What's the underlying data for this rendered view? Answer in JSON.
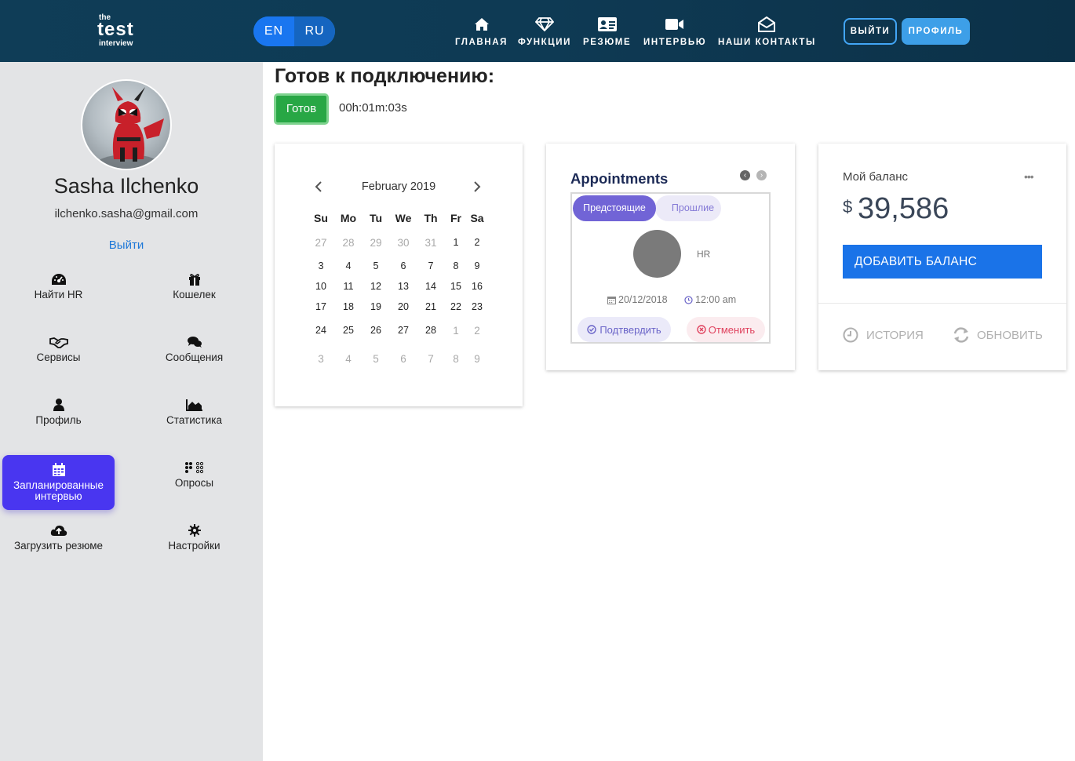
{
  "brand": {
    "line1": "the",
    "line2": "test",
    "line3": "interview"
  },
  "languages": [
    "EN",
    "RU"
  ],
  "nav": [
    {
      "label": "ГЛАВНАЯ",
      "icon": "home-icon"
    },
    {
      "label": "ФУНКЦИИ",
      "icon": "diamond-icon"
    },
    {
      "label": "РЕЗЮМЕ",
      "icon": "id-card-icon"
    },
    {
      "label": "ИНТЕРВЬЮ",
      "icon": "video-camera-icon"
    },
    {
      "label": "НАШИ КОНТАКТЫ",
      "icon": "envelope-open-icon"
    }
  ],
  "header_buttons": {
    "logout": "ВЫЙТИ",
    "profile": "ПРОФИЛЬ"
  },
  "user": {
    "name": "Sasha Ilchenko",
    "email": "ilchenko.sasha@gmail.com",
    "logout": "Выйти"
  },
  "sidebar": [
    {
      "label": "Найти HR",
      "icon": "dashboard-icon"
    },
    {
      "label": "Кошелек",
      "icon": "gift-icon"
    },
    {
      "label": "Сервисы",
      "icon": "handshake-icon"
    },
    {
      "label": "Сообщения",
      "icon": "comments-icon"
    },
    {
      "label": "Профиль",
      "icon": "user-icon"
    },
    {
      "label": "Статистика",
      "icon": "area-chart-icon"
    },
    {
      "label": "Запланированные интервью",
      "icon": "calendar-icon",
      "active": true
    },
    {
      "label": "Опросы",
      "icon": "braille-icon"
    },
    {
      "label": "Загрузить резюме",
      "icon": "cloud-upload-icon"
    },
    {
      "label": "Настройки",
      "icon": "gear-icon"
    }
  ],
  "main": {
    "title": "Готов к подключению:",
    "ready_button": "Готов",
    "timer": "00h:01m:03s"
  },
  "calendar": {
    "month": "February 2019",
    "weekdays": [
      "Su",
      "Mo",
      "Tu",
      "We",
      "Th",
      "Fr",
      "Sa"
    ],
    "weeks": [
      [
        {
          "d": "27",
          "m": true
        },
        {
          "d": "28",
          "m": true
        },
        {
          "d": "29",
          "m": true
        },
        {
          "d": "30",
          "m": true
        },
        {
          "d": "31",
          "m": true
        },
        {
          "d": "1"
        },
        {
          "d": "2"
        }
      ],
      [
        {
          "d": "3"
        },
        {
          "d": "4"
        },
        {
          "d": "5"
        },
        {
          "d": "6"
        },
        {
          "d": "7"
        },
        {
          "d": "8"
        },
        {
          "d": "9"
        }
      ],
      [
        {
          "d": "10"
        },
        {
          "d": "11"
        },
        {
          "d": "12"
        },
        {
          "d": "13"
        },
        {
          "d": "14"
        },
        {
          "d": "15"
        },
        {
          "d": "16"
        }
      ],
      [
        {
          "d": "17"
        },
        {
          "d": "18"
        },
        {
          "d": "19"
        },
        {
          "d": "20"
        },
        {
          "d": "21"
        },
        {
          "d": "22"
        },
        {
          "d": "23"
        }
      ],
      [
        {
          "d": "24"
        },
        {
          "d": "25"
        },
        {
          "d": "26"
        },
        {
          "d": "27"
        },
        {
          "d": "28"
        },
        {
          "d": "1",
          "m": true
        },
        {
          "d": "2",
          "m": true
        }
      ],
      [
        {
          "d": "3",
          "m": true
        },
        {
          "d": "4",
          "m": true
        },
        {
          "d": "5",
          "m": true
        },
        {
          "d": "6",
          "m": true
        },
        {
          "d": "7",
          "m": true
        },
        {
          "d": "8",
          "m": true
        },
        {
          "d": "9",
          "m": true
        }
      ]
    ]
  },
  "appointments": {
    "title": "Appointments",
    "tab_upcoming": "Предстоящие",
    "tab_past": "Прошлие",
    "role": "HR",
    "date": "20/12/2018",
    "time": "12:00 am",
    "confirm": "Подтвердить",
    "cancel": "Отменить"
  },
  "balance": {
    "label": "Мой баланс",
    "currency": "$",
    "amount": "39,586",
    "add_button": "ДОБАВИТЬ БАЛАНС",
    "history": "ИСТОРИЯ",
    "refresh": "ОБНОВИТЬ"
  },
  "colors": {
    "header": "#0f3d57",
    "accent": "#1a73e8",
    "active_menu": "#4936f0",
    "ready": "#28a745",
    "sidebar_bg": "#e3e4e6"
  }
}
